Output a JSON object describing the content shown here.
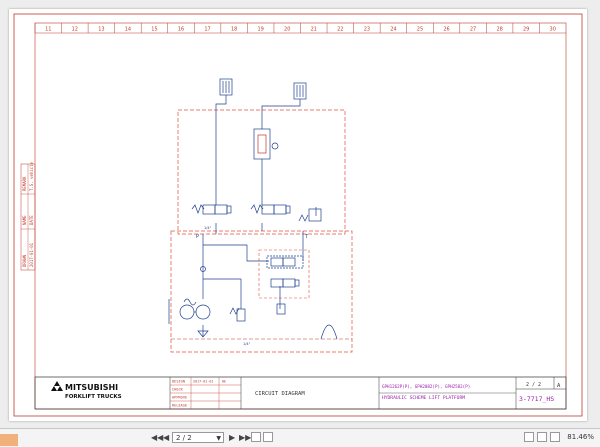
{
  "viewer": {
    "page_indicator": "2 / 2",
    "zoom": "81.46%"
  },
  "sheet": {
    "column_numbers": [
      "11",
      "12",
      "13",
      "14",
      "15",
      "16",
      "17",
      "18",
      "19",
      "20",
      "21",
      "22",
      "23",
      "24",
      "25",
      "26",
      "27",
      "28",
      "29",
      "30"
    ],
    "left_margin_labels": [
      "REMARK",
      "T.S. vehicle",
      "NAME",
      "DATE",
      "DRAWN",
      "2017-01-01"
    ],
    "port_labels": {
      "p": "P",
      "t": "T"
    },
    "signals": {
      "top": "1/4\"",
      "bottom": "1/4\""
    }
  },
  "title_block": {
    "logo_name": "MITSUBISHI",
    "logo_sub": "FORKLIFT TRUCKS",
    "rev_rows": [
      "DESIGN",
      "CHECK",
      "APPROVE",
      "RELEASE"
    ],
    "rev_dates": [
      "2017-01-01",
      "",
      "",
      ""
    ],
    "rev_names": [
      "HE",
      "",
      "",
      ""
    ],
    "drawing_title": "CIRCUIT DIAGRAM",
    "models": "GPH1262P(P), GPH2082(P), GPH2582(P)",
    "description": "HYDRAULIC SCHEME LIFT PLATFORM",
    "sheet_no": "2 / 2",
    "rev_letter": "A",
    "drawing_no": "3-7717_HS"
  }
}
